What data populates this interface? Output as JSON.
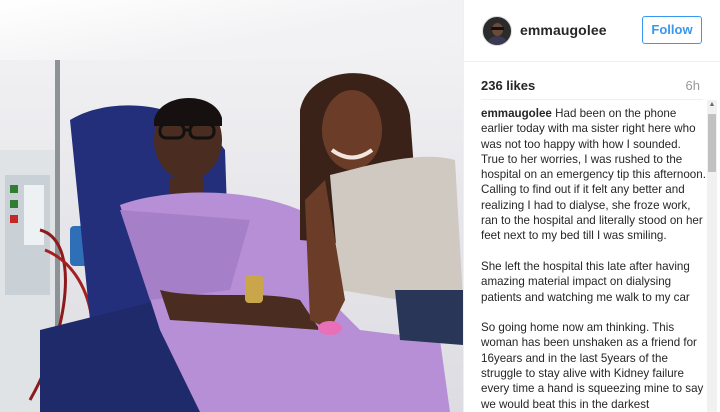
{
  "post": {
    "username": "emmaugolee",
    "follow_label": "Follow",
    "likes": "236 likes",
    "age": "6h"
  },
  "caption": {
    "username": "emmaugolee",
    "paragraph1": "Had been on the phone earlier today with ma sister right here who was not too happy with how I sounded.",
    "paragraph1b": "True to her worries, I was rushed to the hospital on an emergency tip this afternoon. Calling to find out if it felt any better and realizing I had to dialyse, she froze work, ran to the hospital and literally stood on her feet next to my bed till I was smiling.",
    "paragraph2": "She left the hospital this late after having amazing material impact on dialysing patients and watching me walk to my car",
    "paragraph3": "So going home now am thinking. This woman has been unshaken as a friend for 16years and in the last 5years of the struggle to stay alive with Kidney failure every time a hand is squeezing mine to say we would beat this in the darkest"
  },
  "icons": {
    "avatar": "avatar-image",
    "scroll_up": "chevron-up-icon"
  },
  "colors": {
    "accent": "#3897f0",
    "text": "#262626",
    "muted": "#999999",
    "gown": "#b78fd6"
  }
}
